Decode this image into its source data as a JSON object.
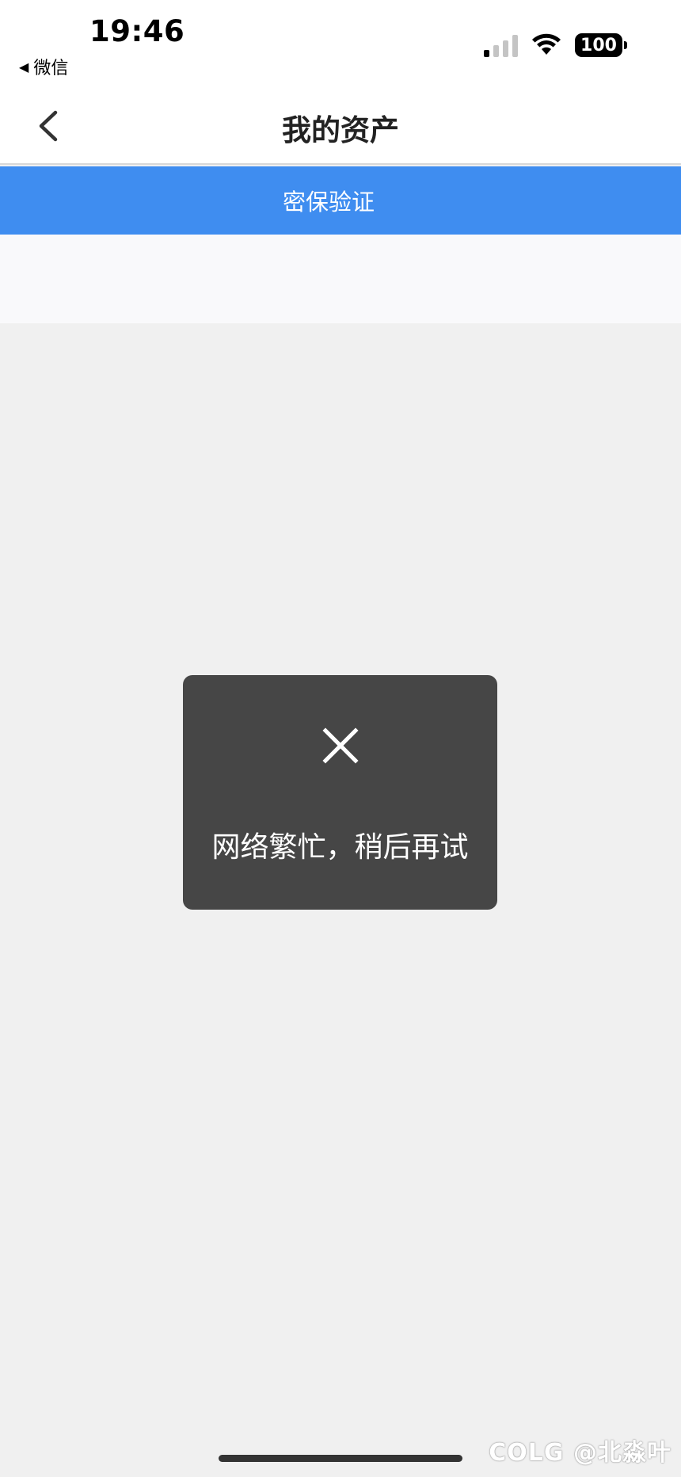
{
  "status_bar": {
    "time": "19:46",
    "back_app_label": "微信",
    "battery": "100",
    "signal_bars_on": 1,
    "signal_bars_total": 4
  },
  "navbar": {
    "title": "我的资产"
  },
  "banner": {
    "label": "密保验证",
    "color": "#3f8df0"
  },
  "toast": {
    "icon": "close-icon",
    "message": "网络繁忙，稍后再试"
  },
  "watermark": {
    "text": "COLG @北淼叶"
  }
}
